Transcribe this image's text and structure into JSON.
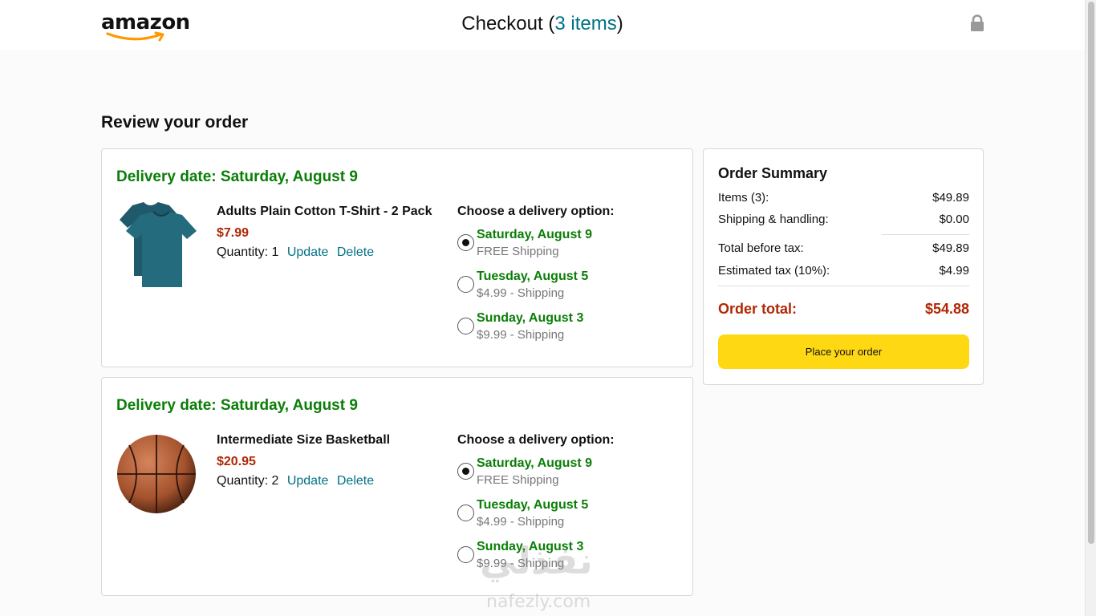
{
  "header": {
    "logo_text": "amazon",
    "checkout_prefix": "Checkout (",
    "checkout_items": "3 items",
    "checkout_suffix": ")"
  },
  "page_heading": "Review your order",
  "orders": [
    {
      "delivery_date": "Delivery date: Saturday, August 9",
      "title": "Adults Plain Cotton T-Shirt - 2 Pack",
      "price": "$7.99",
      "quantity_label": "Quantity: 1",
      "update_label": "Update",
      "delete_label": "Delete",
      "options_heading": "Choose a delivery option:",
      "options": [
        {
          "date": "Saturday, August 9",
          "shipping": "FREE Shipping",
          "selected": true
        },
        {
          "date": "Tuesday, August 5",
          "shipping": "$4.99 - Shipping",
          "selected": false
        },
        {
          "date": "Sunday, August 3",
          "shipping": "$9.99 - Shipping",
          "selected": false
        }
      ]
    },
    {
      "delivery_date": "Delivery date: Saturday, August 9",
      "title": "Intermediate Size Basketball",
      "price": "$20.95",
      "quantity_label": "Quantity: 2",
      "update_label": "Update",
      "delete_label": "Delete",
      "options_heading": "Choose a delivery option:",
      "options": [
        {
          "date": "Saturday, August 9",
          "shipping": "FREE Shipping",
          "selected": true
        },
        {
          "date": "Tuesday, August 5",
          "shipping": "$4.99 - Shipping",
          "selected": false
        },
        {
          "date": "Sunday, August 3",
          "shipping": "$9.99 - Shipping",
          "selected": false
        }
      ]
    }
  ],
  "summary": {
    "title": "Order Summary",
    "items_label": "Items (3):",
    "items_value": "$49.89",
    "shipping_label": "Shipping & handling:",
    "shipping_value": "$0.00",
    "before_tax_label": "Total before tax:",
    "before_tax_value": "$49.89",
    "tax_label": "Estimated tax (10%):",
    "tax_value": "$4.99",
    "total_label": "Order total:",
    "total_value": "$54.88",
    "place_order_label": "Place your order"
  },
  "watermark": {
    "arabic": "نفذلي",
    "latin": "nafezly.com"
  },
  "colors": {
    "accent_link": "#007185",
    "delivery_green": "#0a7e07",
    "price_red": "#B12704",
    "button_yellow": "#FFD814"
  },
  "icons": [
    "lock-icon",
    "amazon-smile-logo",
    "tshirt-product-image",
    "basketball-product-image"
  ]
}
